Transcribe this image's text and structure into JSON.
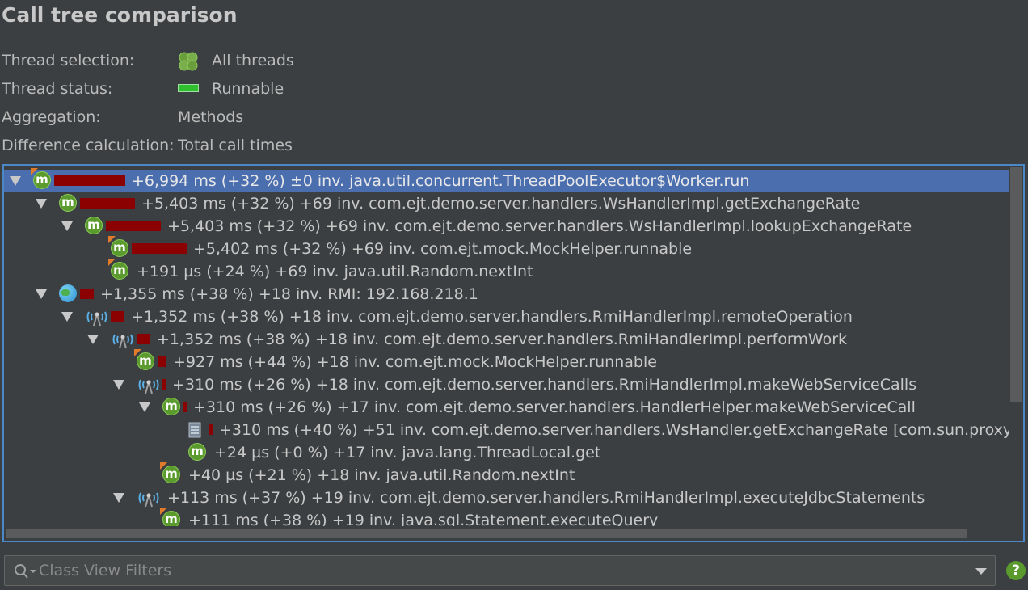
{
  "page": {
    "title": "Call tree comparison"
  },
  "info": [
    {
      "label": "Thread selection:",
      "value": "All threads",
      "icon": "threads-icon"
    },
    {
      "label": "Thread status:",
      "value": "Runnable",
      "icon": "status-icon",
      "status_color": "#2fbf2f"
    },
    {
      "label": "Aggregation:",
      "value": "Methods",
      "icon": ""
    },
    {
      "label": "Difference calculation:",
      "value": "Total call times",
      "icon": ""
    }
  ],
  "tree": {
    "rows": [
      {
        "depth": 0,
        "expanded": true,
        "icon": "method",
        "flag": true,
        "bar": 1.0,
        "text": "+6,994 ms (+32 %) ±0 inv. java.util.concurrent.ThreadPoolExecutor$Worker.run",
        "selected": true
      },
      {
        "depth": 1,
        "expanded": true,
        "icon": "method",
        "flag": false,
        "bar": 0.77,
        "text": "+5,403 ms (+32 %) +69 inv. com.ejt.demo.server.handlers.WsHandlerImpl.getExchangeRate",
        "selected": false
      },
      {
        "depth": 2,
        "expanded": true,
        "icon": "method",
        "flag": false,
        "bar": 0.77,
        "text": "+5,403 ms (+32 %) +69 inv. com.ejt.demo.server.handlers.WsHandlerImpl.lookupExchangeRate",
        "selected": false
      },
      {
        "depth": 3,
        "expanded": null,
        "icon": "method",
        "flag": true,
        "bar": 0.77,
        "text": "+5,402 ms (+32 %) +69 inv. com.ejt.mock.MockHelper.runnable",
        "selected": false
      },
      {
        "depth": 3,
        "expanded": null,
        "icon": "method",
        "flag": true,
        "bar": 0,
        "text": "+191 µs (+24 %) +69 inv. java.util.Random.nextInt",
        "selected": false
      },
      {
        "depth": 1,
        "expanded": true,
        "icon": "globe",
        "flag": false,
        "bar": 0.19,
        "text": "+1,355 ms (+38 %) +18 inv. RMI: 192.168.218.1",
        "selected": false
      },
      {
        "depth": 2,
        "expanded": true,
        "icon": "rmi",
        "flag": false,
        "bar": 0.19,
        "text": "+1,352 ms (+38 %) +18 inv. com.ejt.demo.server.handlers.RmiHandlerImpl.remoteOperation",
        "selected": false
      },
      {
        "depth": 3,
        "expanded": true,
        "icon": "rmi",
        "flag": false,
        "bar": 0.19,
        "text": "+1,352 ms (+38 %) +18 inv. com.ejt.demo.server.handlers.RmiHandlerImpl.performWork",
        "selected": false
      },
      {
        "depth": 4,
        "expanded": null,
        "icon": "method",
        "flag": true,
        "bar": 0.13,
        "text": "+927 ms (+44 %) +18 inv. com.ejt.mock.MockHelper.runnable",
        "selected": false
      },
      {
        "depth": 4,
        "expanded": true,
        "icon": "rmi",
        "flag": false,
        "bar": 0.05,
        "text": "+310 ms (+26 %) +18 inv. com.ejt.demo.server.handlers.RmiHandlerImpl.makeWebServiceCalls",
        "selected": false
      },
      {
        "depth": 5,
        "expanded": true,
        "icon": "method",
        "flag": false,
        "bar": 0.05,
        "text": "+310 ms (+26 %) +17 inv. com.ejt.demo.server.handlers.HandlerHelper.makeWebServiceCall",
        "selected": false
      },
      {
        "depth": 6,
        "expanded": null,
        "icon": "jar",
        "flag": false,
        "bar": 0.05,
        "text": "+310 ms (+40 %) +51 inv. com.ejt.demo.server.handlers.WsHandler.getExchangeRate [com.sun.proxy.$Pro",
        "selected": false
      },
      {
        "depth": 6,
        "expanded": null,
        "icon": "method",
        "flag": false,
        "bar": 0,
        "text": "+24 µs (+0 %) +17 inv. java.lang.ThreadLocal.get",
        "selected": false
      },
      {
        "depth": 5,
        "expanded": null,
        "icon": "method",
        "flag": true,
        "bar": 0,
        "text": "+40 µs (+21 %) +18 inv. java.util.Random.nextInt",
        "selected": false
      },
      {
        "depth": 4,
        "expanded": true,
        "icon": "rmi",
        "flag": false,
        "bar": 0,
        "text": "+113 ms (+37 %) +19 inv. com.ejt.demo.server.handlers.RmiHandlerImpl.executeJdbcStatements",
        "selected": false
      },
      {
        "depth": 5,
        "expanded": null,
        "icon": "method",
        "flag": true,
        "bar": 0,
        "text": "+111 ms (+38 %) +19 inv. java.sql.Statement.executeQuery",
        "selected": false
      }
    ]
  },
  "filter": {
    "placeholder": "Class View Filters",
    "value": ""
  },
  "help": {
    "label": "?"
  },
  "colors": {
    "selection": "#4b6eaf",
    "bar": "#8b0000",
    "method_icon": "#5b9a2d",
    "panel_border": "#4a88c7"
  }
}
